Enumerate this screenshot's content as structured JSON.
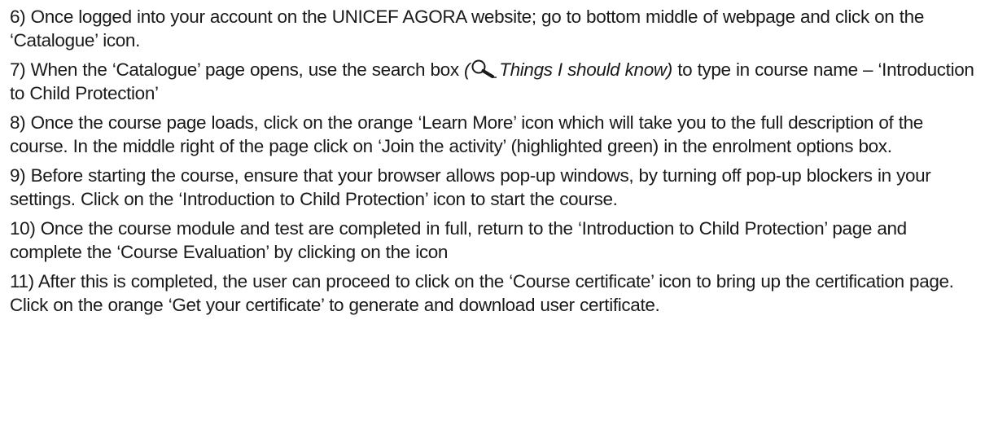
{
  "steps": [
    {
      "text": "6) Once logged into your account on the UNICEF AGORA website; go to bottom middle of webpage and click on the ‘Catalogue’ icon."
    },
    {
      "before": "7) When the ‘Catalogue’ page opens, use the search box ",
      "paren_open": "(",
      "italic": "Things I should know)",
      "after": " to type in course name – ‘Introduction to Child Protection’",
      "icon": "search-icon"
    },
    {
      "text": "8) Once the course page loads, click on the orange ‘Learn More’ icon which will take you to the full description of the course. In the middle right of the page click on ‘Join the activity’ (highlighted green) in the enrolment options box."
    },
    {
      "text": "9) Before starting the course, ensure that your browser allows pop-up windows, by turning off pop-up blockers in your settings. Click on the ‘Introduction to Child Protection’ icon to start the course."
    },
    {
      "text": "10) Once the course module and test are completed in full, return to the ‘Introduction to Child Protection’ page and complete the ‘Course Evaluation’ by clicking on the icon"
    },
    {
      "text": "11) After this is completed, the user can proceed to click on the ‘Course certificate’ icon to bring up the certification page. Click on the orange ‘Get your certificate’ to generate and download user certificate."
    }
  ]
}
